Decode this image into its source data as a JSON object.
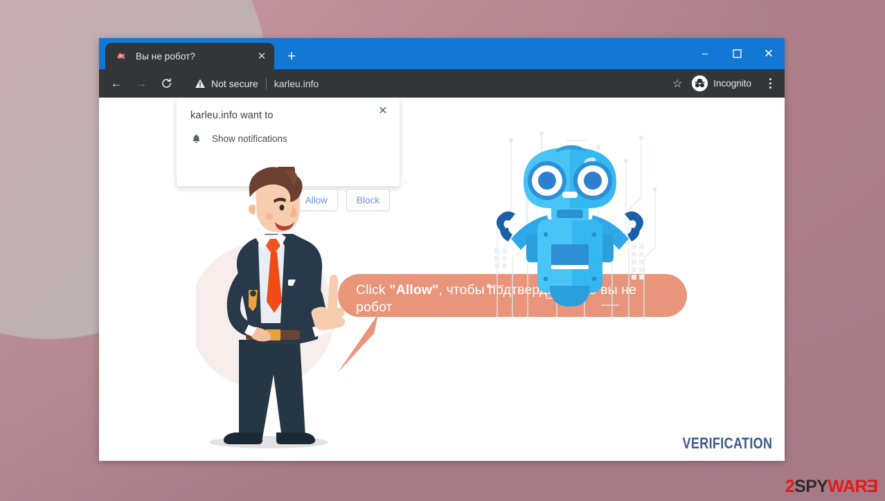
{
  "window": {
    "controls": {
      "minimize": "–",
      "maximize": "□",
      "close": "✕"
    }
  },
  "tab": {
    "title": "Вы не робот?",
    "close": "✕",
    "new_tab": "+",
    "favicon_name": "site-favicon"
  },
  "toolbar": {
    "back": "←",
    "forward": "→",
    "reload": "⟳",
    "security_label": "Not secure",
    "url": "karleu.info",
    "star": "☆",
    "incognito_label": "Incognito",
    "menu": "kebab-menu"
  },
  "permission_dialog": {
    "title": "karleu.info want to",
    "permission": "Show notifications",
    "close": "✕",
    "allow_label": "Allow",
    "block_label": "Block"
  },
  "page": {
    "bubble": {
      "lead": "Click ",
      "emphasis": "\"Allow\"",
      "rest": ", чтобы подтвердить, что вы не робот",
      "color": "#e8957b"
    },
    "verification_label": "VERIFICATION",
    "man_illustration": "businessman-pointing-up",
    "robot_illustration": "blue-robot-mascot"
  },
  "watermark": {
    "part1": "2",
    "part2": "SPY",
    "part3": "WAR",
    "part4": "E",
    "red": "#e01b17",
    "dark": "#2b2b2b"
  },
  "colors": {
    "titlebar_blue": "#1278d4",
    "chrome_dark": "#323639",
    "tab_dark": "#323639",
    "bubble": "#e8957b",
    "verification_blue": "#3b5a87",
    "page_bg": "#b0808c"
  }
}
